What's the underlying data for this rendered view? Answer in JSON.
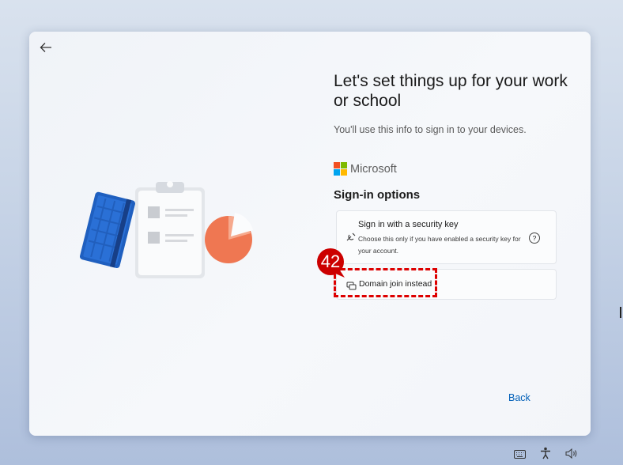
{
  "header": {
    "title": "Let's set things up for your work or school",
    "subtitle": "You'll use this info to sign in to your devices."
  },
  "brand": {
    "name": "Microsoft",
    "colors": [
      "#f25022",
      "#7fba00",
      "#00a4ef",
      "#ffb900"
    ]
  },
  "signin": {
    "section_title": "Sign-in options",
    "security_key": {
      "title": "Sign in with a security key",
      "description": "Choose this only if you have enabled a security key for your account."
    },
    "help_glyph": "?",
    "domain_join_label": "Domain join instead"
  },
  "annotation": {
    "step_number": "42",
    "color": "#cc0000"
  },
  "footer": {
    "back_label": "Back"
  },
  "icons": [
    "back-arrow-icon",
    "security-key-icon",
    "help-icon",
    "domain-join-icon",
    "keyboard-icon",
    "accessibility-icon",
    "volume-icon"
  ]
}
